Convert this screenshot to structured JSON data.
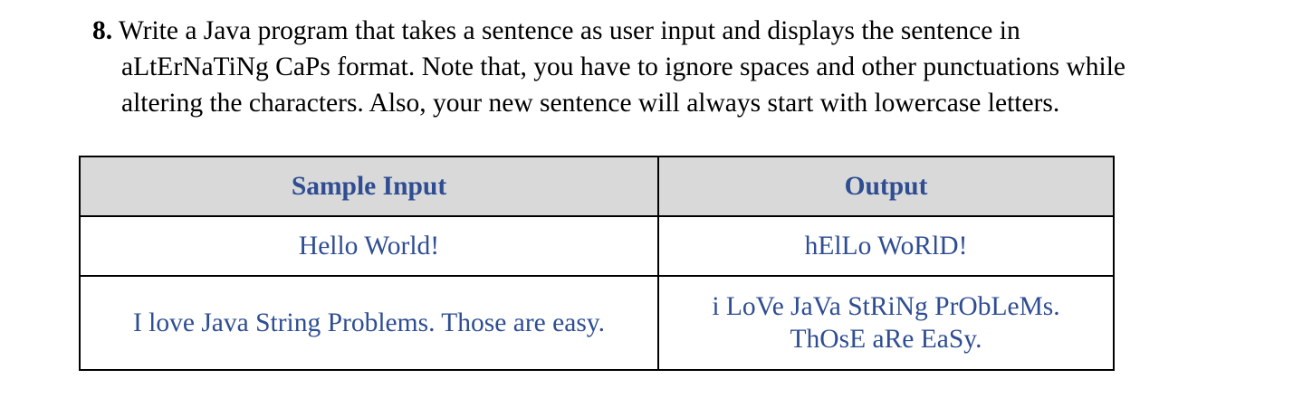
{
  "question": {
    "number": "8.",
    "lines": [
      "Write a Java program that takes a sentence as user input and displays the sentence in",
      "aLtErNaTiNg CaPs format. Note that, you have to ignore spaces and other punctuations while",
      "altering the characters. Also, your new sentence will always start with lowercase letters."
    ]
  },
  "table": {
    "headers": [
      "Sample Input",
      "Output"
    ],
    "rows": [
      {
        "input": "Hello World!",
        "output_lines": [
          "hElLo WoRlD!"
        ]
      },
      {
        "input": "I love Java String Problems. Those are easy.",
        "output_lines": [
          "i LoVe JaVa StRiNg PrObLeMs.",
          "ThOsE aRe EaSy."
        ]
      }
    ]
  },
  "colors": {
    "table_text": "#2e4d92",
    "header_background": "#d9d9d9",
    "border": "#000000"
  }
}
